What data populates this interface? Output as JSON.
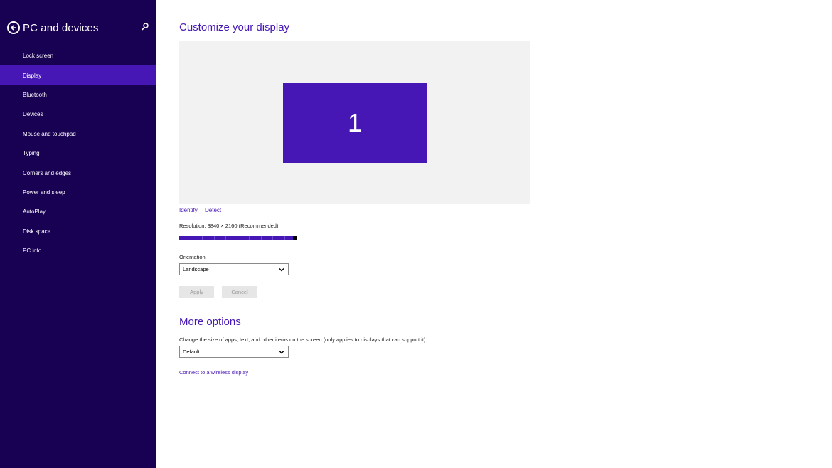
{
  "colors": {
    "sidebar_bg": "#180052",
    "accent": "#4617b4",
    "display_area_bg": "#f2f2f2"
  },
  "sidebar": {
    "title": "PC and devices",
    "back_icon": "back-arrow-circle-icon",
    "search_icon": "search-icon",
    "items": [
      {
        "label": "Lock screen",
        "active": false
      },
      {
        "label": "Display",
        "active": true
      },
      {
        "label": "Bluetooth",
        "active": false
      },
      {
        "label": "Devices",
        "active": false
      },
      {
        "label": "Mouse and touchpad",
        "active": false
      },
      {
        "label": "Typing",
        "active": false
      },
      {
        "label": "Corners and edges",
        "active": false
      },
      {
        "label": "Power and sleep",
        "active": false
      },
      {
        "label": "AutoPlay",
        "active": false
      },
      {
        "label": "Disk space",
        "active": false
      },
      {
        "label": "PC info",
        "active": false
      }
    ]
  },
  "main": {
    "heading": "Customize your display",
    "monitor_number": "1",
    "identify_label": "Identify",
    "detect_label": "Detect",
    "resolution_label": "Resolution: 3840 × 2160 (Recommended)",
    "resolution_slider_level": 1.0,
    "orientation_label": "Orientation",
    "orientation_value": "Landscape",
    "apply_label": "Apply",
    "cancel_label": "Cancel",
    "more_heading": "More options",
    "size_label": "Change the size of apps, text, and other items on the screen (only applies to displays that can support it)",
    "size_value": "Default",
    "wireless_link": "Connect to a wireless display"
  }
}
